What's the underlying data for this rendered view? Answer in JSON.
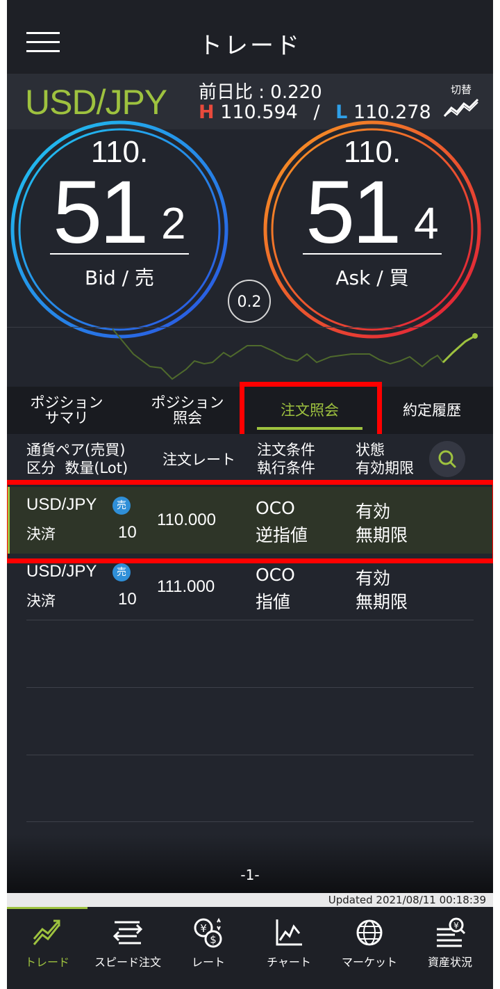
{
  "header": {
    "title": "トレード"
  },
  "pair_bar": {
    "pair": "USD/JPY",
    "change_label": "前日比 : 0.220",
    "high_label": "H",
    "high_value": "110.594",
    "separator": "/",
    "low_label": "L",
    "low_value": "110.278",
    "switch_label": "切替"
  },
  "bid": {
    "prefix": "110.",
    "big": "51",
    "small": "2",
    "label": "Bid / 売"
  },
  "ask": {
    "prefix": "110.",
    "big": "51",
    "small": "4",
    "label": "Ask / 買"
  },
  "spread": "0.2",
  "tabs": [
    {
      "label": "ポジション\nサマリ"
    },
    {
      "label": "ポジション\n照会"
    },
    {
      "label": "注文照会"
    },
    {
      "label": "約定履歴"
    }
  ],
  "columns": {
    "col1": "通貨ペア(売買)\n区分  数量(Lot)",
    "col2": "注文レート",
    "col3": "注文条件\n執行条件",
    "col4": "状態\n有効期限"
  },
  "orders": [
    {
      "pair": "USD/JPY",
      "side": "売",
      "kubun": "決済",
      "qty": "10",
      "rate": "110.000",
      "cond": "OCO",
      "exec": "逆指値",
      "status": "有効",
      "expiry": "無期限"
    },
    {
      "pair": "USD/JPY",
      "side": "売",
      "kubun": "決済",
      "qty": "10",
      "rate": "111.000",
      "cond": "OCO",
      "exec": "指値",
      "status": "有効",
      "expiry": "無期限"
    }
  ],
  "pager": "-1-",
  "updated": "Updated  2021/08/11 00:18:39",
  "nav": [
    {
      "label": "トレード",
      "icon": "trade-chart-icon"
    },
    {
      "label": "スピード注文",
      "icon": "speed-order-icon"
    },
    {
      "label": "レート",
      "icon": "currency-rate-icon"
    },
    {
      "label": "チャート",
      "icon": "chart-icon"
    },
    {
      "label": "マーケット",
      "icon": "globe-icon"
    },
    {
      "label": "資産状況",
      "icon": "assets-icon"
    }
  ],
  "colors": {
    "accent": "#9ec23f",
    "high": "#e84a3c",
    "low": "#2fa0e8",
    "highlight": "#ff0000"
  }
}
